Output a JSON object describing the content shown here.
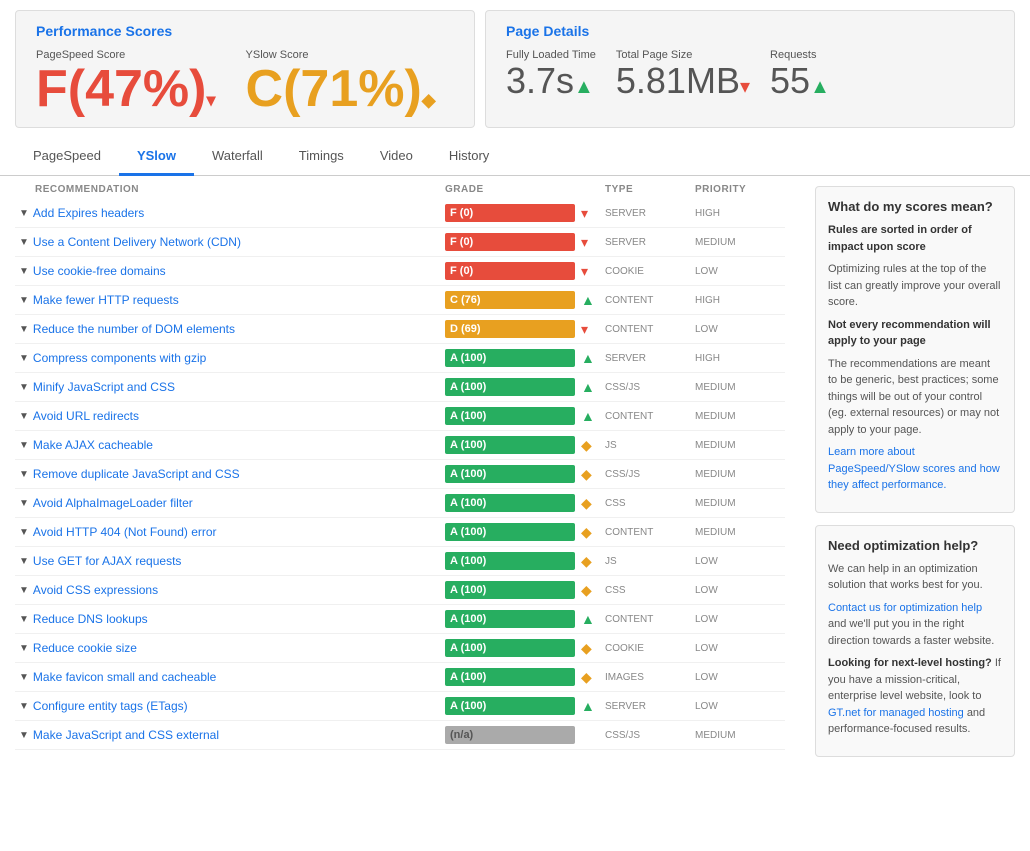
{
  "performance": {
    "title": "Performance Scores",
    "pagespeed": {
      "label": "PageSpeed Score",
      "value": "F(47%)",
      "arrow": "▾"
    },
    "yslow": {
      "label": "YSlow Score",
      "value": "C(71%)",
      "arrow": "◆"
    }
  },
  "pageDetails": {
    "title": "Page Details",
    "fullyLoaded": {
      "label": "Fully Loaded Time",
      "value": "3.7s",
      "arrow": "▲"
    },
    "totalSize": {
      "label": "Total Page Size",
      "value": "5.81MB",
      "arrow": "▾"
    },
    "requests": {
      "label": "Requests",
      "value": "55",
      "arrow": "▲"
    }
  },
  "tabs": [
    {
      "id": "pagespeed",
      "label": "PageSpeed",
      "active": false
    },
    {
      "id": "yslow",
      "label": "YSlow",
      "active": true
    },
    {
      "id": "waterfall",
      "label": "Waterfall",
      "active": false
    },
    {
      "id": "timings",
      "label": "Timings",
      "active": false
    },
    {
      "id": "video",
      "label": "Video",
      "active": false
    },
    {
      "id": "history",
      "label": "History",
      "active": false
    }
  ],
  "tableHeaders": {
    "recommendation": "Recommendation",
    "grade": "Grade",
    "type": "Type",
    "priority": "Priority"
  },
  "recommendations": [
    {
      "name": "Add Expires headers",
      "grade": "F (0)",
      "gradeType": "red",
      "gradeWidth": 100,
      "arrowType": "red",
      "arrow": "▾",
      "type": "SERVER",
      "priority": "HIGH"
    },
    {
      "name": "Use a Content Delivery Network (CDN)",
      "grade": "F (0)",
      "gradeType": "red",
      "gradeWidth": 100,
      "arrowType": "red",
      "arrow": "▾",
      "type": "SERVER",
      "priority": "MEDIUM"
    },
    {
      "name": "Use cookie-free domains",
      "grade": "F (0)",
      "gradeType": "red",
      "gradeWidth": 100,
      "arrowType": "red",
      "arrow": "▾",
      "type": "COOKIE",
      "priority": "LOW"
    },
    {
      "name": "Make fewer HTTP requests",
      "grade": "C (76)",
      "gradeType": "orange",
      "gradeWidth": 76,
      "arrowType": "green",
      "arrow": "▲",
      "type": "CONTENT",
      "priority": "HIGH"
    },
    {
      "name": "Reduce the number of DOM elements",
      "grade": "D (69)",
      "gradeType": "orange",
      "gradeWidth": 69,
      "arrowType": "red",
      "arrow": "▾",
      "type": "CONTENT",
      "priority": "LOW"
    },
    {
      "name": "Compress components with gzip",
      "grade": "A (100)",
      "gradeType": "green",
      "gradeWidth": 100,
      "arrowType": "green",
      "arrow": "▲",
      "type": "SERVER",
      "priority": "HIGH"
    },
    {
      "name": "Minify JavaScript and CSS",
      "grade": "A (100)",
      "gradeType": "green",
      "gradeWidth": 100,
      "arrowType": "green",
      "arrow": "▲",
      "type": "CSS/JS",
      "priority": "MEDIUM"
    },
    {
      "name": "Avoid URL redirects",
      "grade": "A (100)",
      "gradeType": "green",
      "gradeWidth": 100,
      "arrowType": "green",
      "arrow": "▲",
      "type": "CONTENT",
      "priority": "MEDIUM"
    },
    {
      "name": "Make AJAX cacheable",
      "grade": "A (100)",
      "gradeType": "green",
      "gradeWidth": 100,
      "arrowType": "orange",
      "arrow": "◆",
      "type": "JS",
      "priority": "MEDIUM"
    },
    {
      "name": "Remove duplicate JavaScript and CSS",
      "grade": "A (100)",
      "gradeType": "green",
      "gradeWidth": 100,
      "arrowType": "orange",
      "arrow": "◆",
      "type": "CSS/JS",
      "priority": "MEDIUM"
    },
    {
      "name": "Avoid AlphaImageLoader filter",
      "grade": "A (100)",
      "gradeType": "green",
      "gradeWidth": 100,
      "arrowType": "orange",
      "arrow": "◆",
      "type": "CSS",
      "priority": "MEDIUM"
    },
    {
      "name": "Avoid HTTP 404 (Not Found) error",
      "grade": "A (100)",
      "gradeType": "green",
      "gradeWidth": 100,
      "arrowType": "orange",
      "arrow": "◆",
      "type": "CONTENT",
      "priority": "MEDIUM"
    },
    {
      "name": "Use GET for AJAX requests",
      "grade": "A (100)",
      "gradeType": "green",
      "gradeWidth": 100,
      "arrowType": "orange",
      "arrow": "◆",
      "type": "JS",
      "priority": "LOW"
    },
    {
      "name": "Avoid CSS expressions",
      "grade": "A (100)",
      "gradeType": "green",
      "gradeWidth": 100,
      "arrowType": "orange",
      "arrow": "◆",
      "type": "CSS",
      "priority": "LOW"
    },
    {
      "name": "Reduce DNS lookups",
      "grade": "A (100)",
      "gradeType": "green",
      "gradeWidth": 100,
      "arrowType": "green",
      "arrow": "▲",
      "type": "CONTENT",
      "priority": "LOW"
    },
    {
      "name": "Reduce cookie size",
      "grade": "A (100)",
      "gradeType": "green",
      "gradeWidth": 100,
      "arrowType": "orange",
      "arrow": "◆",
      "type": "COOKIE",
      "priority": "LOW"
    },
    {
      "name": "Make favicon small and cacheable",
      "grade": "A (100)",
      "gradeType": "green",
      "gradeWidth": 100,
      "arrowType": "orange",
      "arrow": "◆",
      "type": "IMAGES",
      "priority": "LOW"
    },
    {
      "name": "Configure entity tags (ETags)",
      "grade": "A (100)",
      "gradeType": "green",
      "gradeWidth": 100,
      "arrowType": "green",
      "arrow": "▲",
      "type": "SERVER",
      "priority": "LOW"
    },
    {
      "name": "Make JavaScript and CSS external",
      "grade": "(n/a)",
      "gradeType": "gray",
      "gradeWidth": 100,
      "arrowType": "",
      "arrow": "",
      "type": "CSS/JS",
      "priority": "MEDIUM"
    }
  ],
  "sidebar": {
    "whatBox": {
      "title": "What do my scores mean?",
      "bold1": "Rules are sorted in order of impact upon score",
      "text1": "Optimizing rules at the top of the list can greatly improve your overall score.",
      "bold2": "Not every recommendation will apply to your page",
      "text2": "The recommendations are meant to be generic, best practices; some things will be out of your control (eg. external resources) or may not apply to your page.",
      "linkText": "Learn more about PageSpeed/YSlow scores and how they affect performance."
    },
    "needBox": {
      "title": "Need optimization help?",
      "text1": "We can help in an optimization solution that works best for you.",
      "linkText1": "Contact us for optimization help",
      "text2": " and we'll put you in the right direction towards a faster website.",
      "bold3": "Looking for next-level hosting?",
      "text3": " If you have a mission-critical, enterprise level website, look to ",
      "linkText2": "GT.net for managed hosting",
      "text4": " and performance-focused results."
    }
  }
}
